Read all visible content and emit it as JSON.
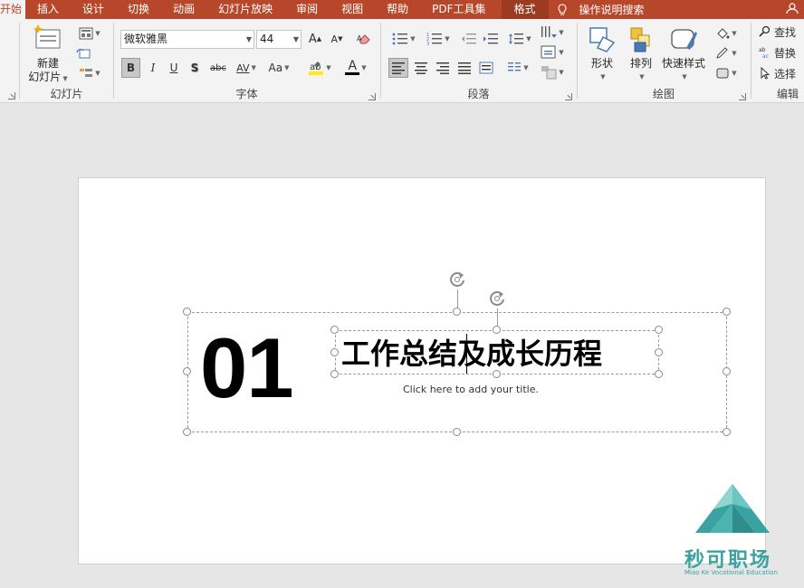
{
  "tabs": [
    "开始",
    "插入",
    "设计",
    "切换",
    "动画",
    "幻灯片放映",
    "审阅",
    "视图",
    "帮助",
    "PDF工具集",
    "格式"
  ],
  "tell_me": "操作说明搜索",
  "groups": {
    "slides": {
      "label": "幻灯片",
      "new_slide_line1": "新建",
      "new_slide_line2": "幻灯片"
    },
    "font": {
      "label": "字体",
      "font_name": "微软雅黑",
      "font_size": "44",
      "bold": "B",
      "italic": "I",
      "underline": "U",
      "shadow": "S",
      "strike": "abc",
      "spacing": "AV",
      "case": "Aa",
      "color_letter": "A"
    },
    "paragraph": {
      "label": "段落"
    },
    "drawing": {
      "label": "绘图",
      "shapes": "形状",
      "arrange": "排列",
      "quick_styles": "快速样式"
    },
    "editing": {
      "label": "编辑",
      "find": "查找",
      "replace": "替换",
      "select": "选择"
    }
  },
  "slide": {
    "number": "01",
    "title": "工作总结及成长历程",
    "subtitle": "Click here to add your title."
  },
  "watermark": {
    "name": "秒可职场",
    "sub": "Miao Ke Vocational Education"
  },
  "colors": {
    "accent": "#b7472a",
    "watermark": "#3aa3a1"
  }
}
